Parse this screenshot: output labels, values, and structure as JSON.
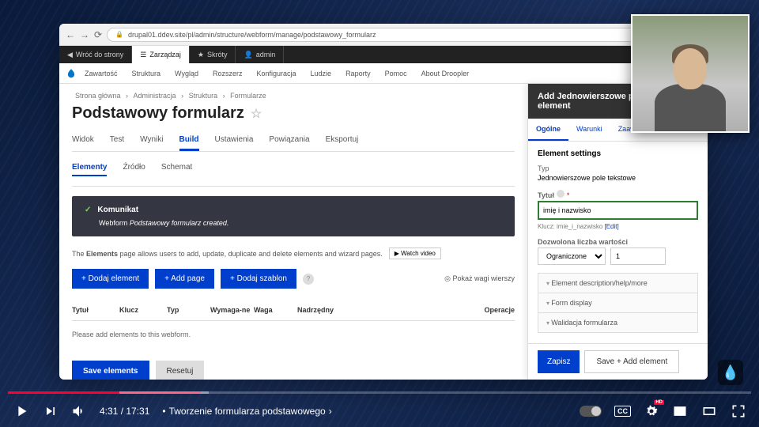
{
  "chrome": {
    "url": "drupal01.ddev.site/pl/admin/structure/webform/manage/podstawowy_formularz"
  },
  "topbar": {
    "back": "Wróć do strony",
    "manage": "Zarządzaj",
    "shortcuts": "Skróty",
    "user": "admin"
  },
  "admin_bar": {
    "items": [
      "Zawartość",
      "Struktura",
      "Wygląd",
      "Rozszerz",
      "Konfiguracja",
      "Ludzie",
      "Raporty",
      "Pomoc",
      "About Droopler"
    ]
  },
  "breadcrumb": [
    "Strona główna",
    "Administracja",
    "Struktura",
    "Formularze"
  ],
  "page_title": "Podstawowy formularz",
  "primary_tabs": [
    "Widok",
    "Test",
    "Wyniki",
    "Build",
    "Ustawienia",
    "Powiązania",
    "Eksportuj"
  ],
  "secondary_tabs": [
    "Elementy",
    "Źródło",
    "Schemat"
  ],
  "message": {
    "title": "Komunikat",
    "prefix": "Webform ",
    "name": "Podstawowy formularz",
    "suffix": " created."
  },
  "help": {
    "text_strong": "Elements",
    "text_pre": "The ",
    "text_post": " page allows users to add, update, duplicate and delete elements and wizard pages.",
    "watch": "▶ Watch video"
  },
  "actions": {
    "add_element": "+ Dodaj element",
    "add_page": "+ Add page",
    "add_template": "+ Dodaj szablon",
    "weights": "◎ Pokaż wagi wierszy"
  },
  "table": {
    "headers": [
      "Tytuł",
      "Klucz",
      "Typ",
      "Wymaga-ne",
      "Waga",
      "Nadrzędny",
      "Operacje"
    ],
    "empty": "Please add elements to this webform."
  },
  "bottom": {
    "save": "Save elements",
    "reset": "Resetuj"
  },
  "sidebar": {
    "title": "Add Jednowierszowe pole tekstowe element",
    "tabs": [
      "Ogólne",
      "Warunki",
      "Zaawansowane"
    ],
    "section": "Element settings",
    "type_label": "Typ",
    "type_value": "Jednowierszowe pole tekstowe",
    "title_label": "Tytuł",
    "title_value": "imię i nazwisko",
    "key_pre": "Klucz: ",
    "key_val": "imie_i_nazwisko",
    "key_edit": "[Edit]",
    "allowed_label": "Dozwolona liczba wartości",
    "allowed_select": "Ograniczone",
    "allowed_num": "1",
    "accordions": [
      "Element description/help/more",
      "Form display",
      "Walidacja formularza"
    ],
    "save": "Zapisz",
    "save_add": "Save + Add element"
  },
  "player": {
    "time": "4:31 / 17:31",
    "chapter": "Tworzenie formularza podstawowego",
    "cc": "CC",
    "hd": "HD"
  }
}
